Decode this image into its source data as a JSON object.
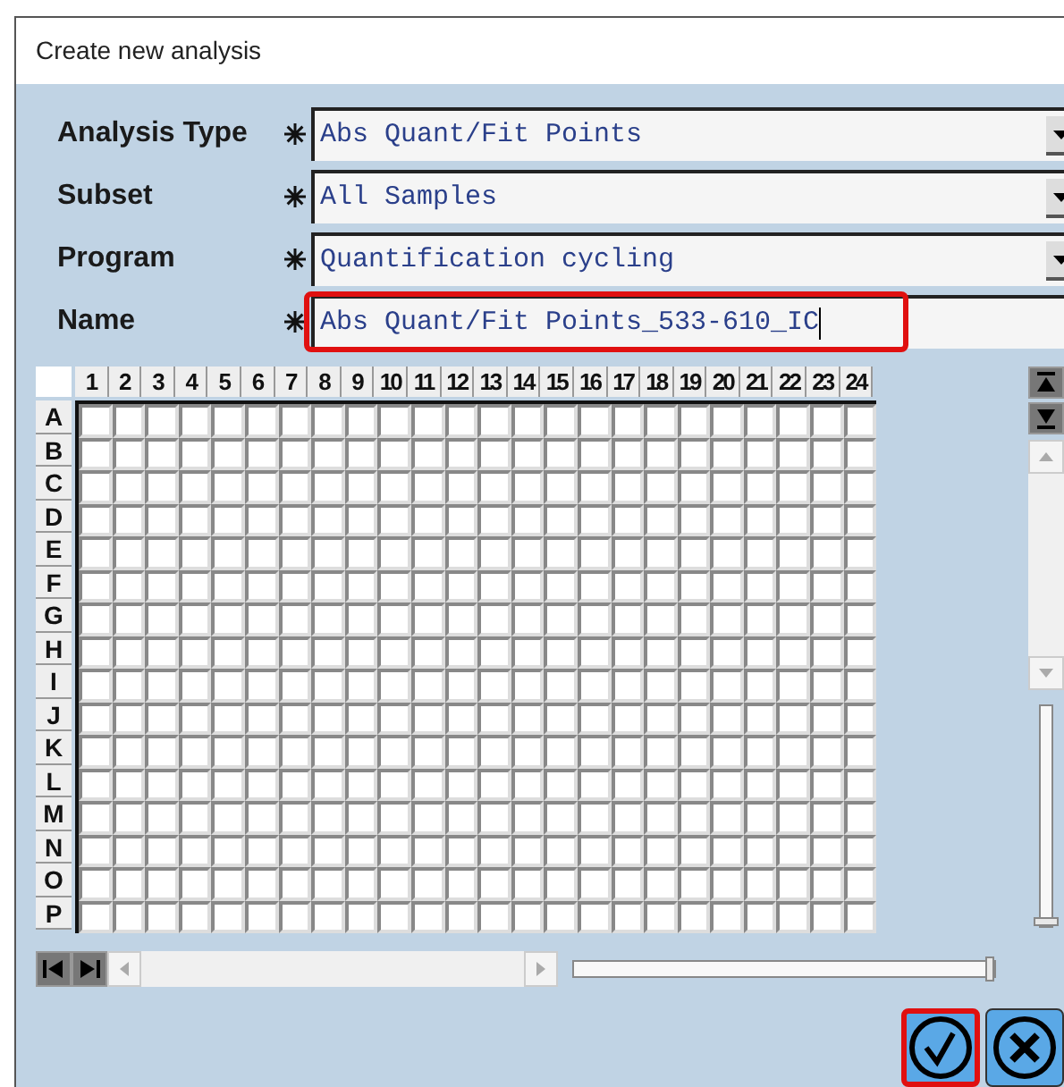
{
  "window": {
    "title": "Create new analysis"
  },
  "form": [
    {
      "kind": "dropdown",
      "label": "Analysis Type",
      "required": true,
      "value": "Abs Quant/Fit Points",
      "highlighted": false
    },
    {
      "kind": "dropdown",
      "label": "Subset",
      "required": true,
      "value": "All Samples",
      "highlighted": false
    },
    {
      "kind": "dropdown",
      "label": "Program",
      "required": true,
      "value": "Quantification cycling",
      "highlighted": false
    },
    {
      "kind": "text",
      "label": "Name",
      "required": true,
      "value": "Abs Quant/Fit Points_533-610_IC",
      "highlighted": true
    }
  ],
  "plate": {
    "columns": [
      "1",
      "2",
      "3",
      "4",
      "5",
      "6",
      "7",
      "8",
      "9",
      "10",
      "11",
      "12",
      "13",
      "14",
      "15",
      "16",
      "17",
      "18",
      "19",
      "20",
      "21",
      "22",
      "23",
      "24"
    ],
    "rows": [
      "A",
      "B",
      "C",
      "D",
      "E",
      "F",
      "G",
      "H",
      "I",
      "J",
      "K",
      "L",
      "M",
      "N",
      "O",
      "P"
    ]
  },
  "zoom_slider": {
    "level": 1
  },
  "buttons": [
    {
      "kind": "ok",
      "highlighted": true
    },
    {
      "kind": "cancel",
      "highlighted": false
    }
  ]
}
